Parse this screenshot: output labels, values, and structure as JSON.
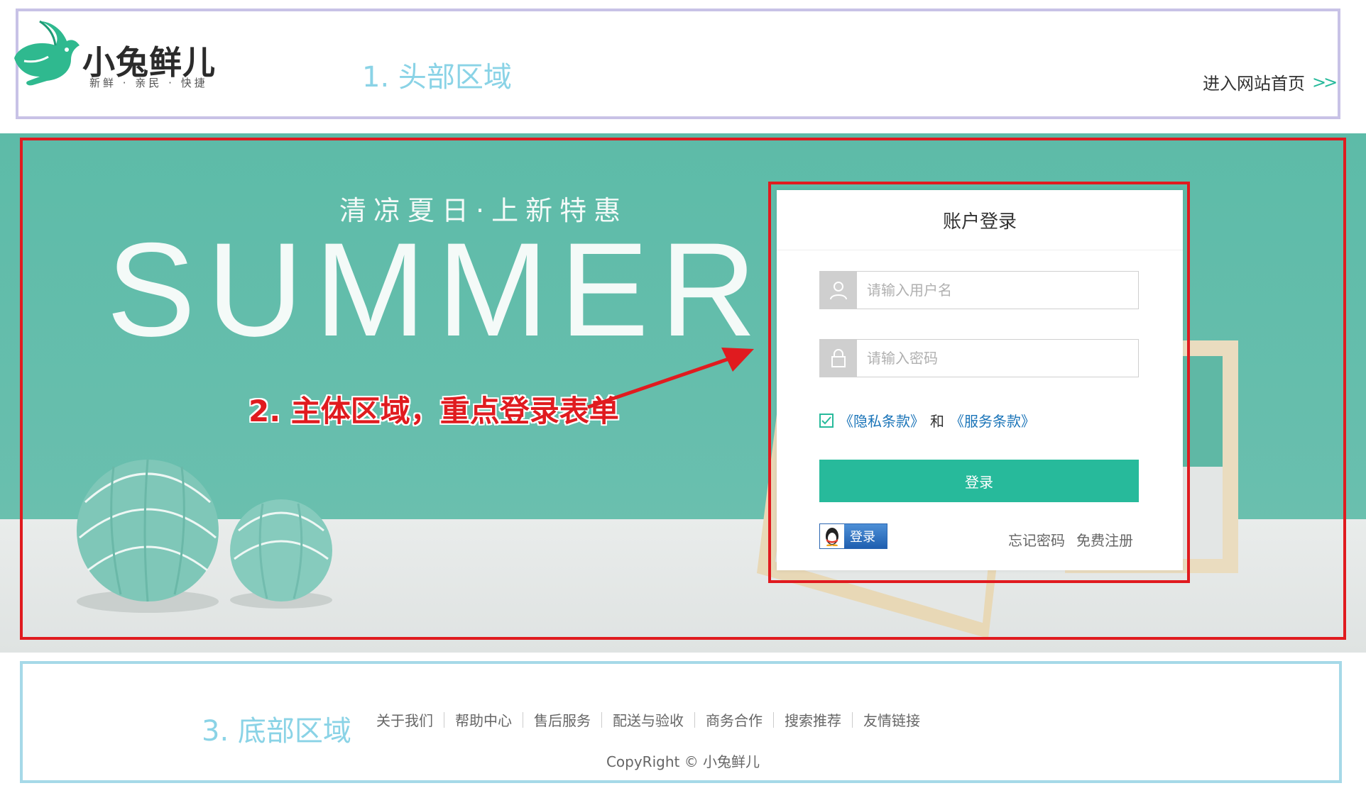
{
  "colors": {
    "accent": "#27ba9b",
    "annotation_red": "#e01b1f",
    "link_blue": "#1a74b8"
  },
  "header": {
    "logo_name": "小兔鲜儿",
    "logo_slogan": "新鲜 · 亲民 · 快捷",
    "region_note": "1. 头部区域",
    "site_link_label": "进入网站首页",
    "site_link_icon": "double-chevron-right-icon"
  },
  "banner": {
    "subtitle": "清凉夏日·上新特惠",
    "big_text": "SUMMER",
    "region_note": "2. 主体区域，重点登录表单"
  },
  "login": {
    "title": "账户登录",
    "username": {
      "placeholder": "请输入用户名",
      "value": "",
      "icon": "user-icon"
    },
    "password": {
      "placeholder": "请输入密码",
      "value": "",
      "icon": "lock-icon"
    },
    "agree_checked": true,
    "privacy_terms": "《隐私条款》",
    "and_text": "和",
    "service_terms": "《服务条款》",
    "submit_label": "登录",
    "qq_login_label": "登录",
    "qq_icon": "qq-penguin-icon",
    "forgot_label": "忘记密码",
    "register_label": "免费注册"
  },
  "footer": {
    "region_note": "3. 底部区域",
    "links": [
      "关于我们",
      "帮助中心",
      "售后服务",
      "配送与验收",
      "商务合作",
      "搜索推荐",
      "友情链接"
    ],
    "copyright": "CopyRight © 小兔鲜儿"
  }
}
